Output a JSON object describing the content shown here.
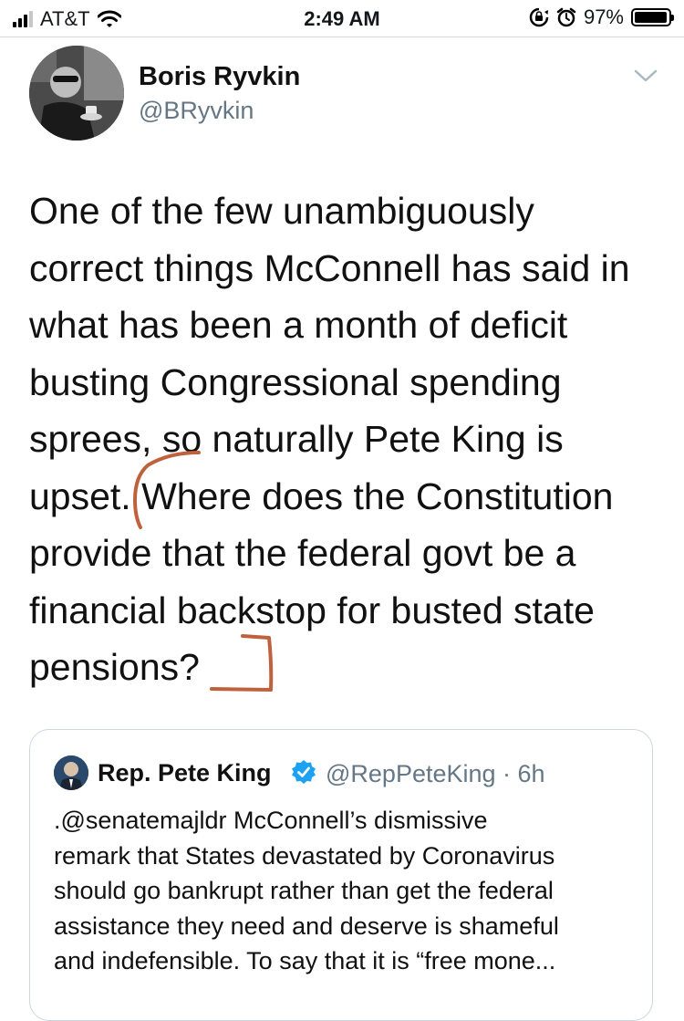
{
  "status_bar": {
    "carrier": "AT&T",
    "time": "2:49 AM",
    "battery_percent": "97%",
    "battery_level": 0.97
  },
  "tweet": {
    "author_name": "Boris Ryvkin",
    "author_handle": "@BRyvkin",
    "lines": [
      "One of the few unambiguously",
      "correct things McConnell has said in",
      "what has been a month of deficit",
      "busting Congressional spending",
      "sprees, so naturally Pete King is",
      "upset. Where does the Constitution",
      "provide that the federal govt be a",
      "financial backstop for busted state",
      "pensions?"
    ],
    "annotation_color": "#c0613e"
  },
  "quoted_tweet": {
    "author_name": "Rep. Pete King",
    "author_handle": "@RepPeteKing · 6h",
    "verified_color": "#1da1f2",
    "lines": [
      ".@senatemajldr McConnell’s dismissive",
      "remark that States devastated by Coronavirus",
      "should go bankrupt rather than get the federal",
      "assistance they need and deserve is shameful",
      "and indefensible. To say that it is “free mone..."
    ]
  },
  "icons": {
    "signal": "signal-bars-icon",
    "wifi": "wifi-icon",
    "rotation_lock": "rotation-lock-icon",
    "alarm": "alarm-clock-icon",
    "battery": "battery-icon",
    "menu": "chevron-down-icon",
    "verified": "verified-badge-icon"
  }
}
